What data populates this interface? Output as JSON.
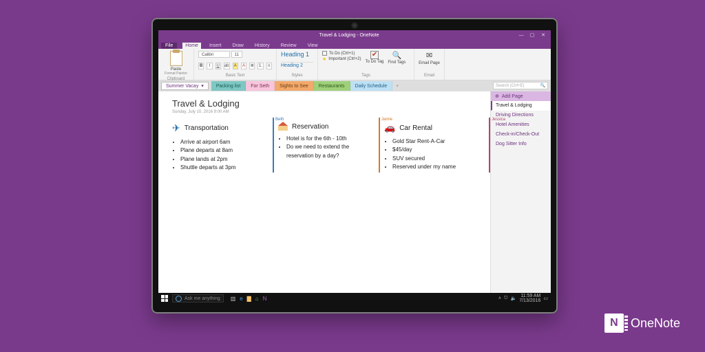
{
  "brand": {
    "letter": "N",
    "name": "OneNote"
  },
  "titlebar": {
    "title": "Travel & Lodging - OneNote",
    "min": "—",
    "max": "▢",
    "close": "✕"
  },
  "tabs": {
    "file": "File",
    "home": "Home",
    "insert": "Insert",
    "draw": "Draw",
    "history": "History",
    "review": "Review",
    "view": "View"
  },
  "ribbon": {
    "paste": "Paste",
    "format_painter": "Format Painter",
    "clipboard_label": "Clipboard",
    "font_name": "Calibri",
    "font_size": "11",
    "btn_bold": "B",
    "btn_italic": "I",
    "btn_underline": "U",
    "basic_label": "Basic Text",
    "heading1": "Heading 1",
    "heading2": "Heading 2",
    "styles_label": "Styles",
    "tag_todo": "To Do (Ctrl+1)",
    "tag_important": "Important (Ctrl+2)",
    "todo_tag_btn": "To Do Tag",
    "find_tags": "Find Tags",
    "tags_label": "Tags",
    "email_page": "Email Page",
    "email_label": "Email"
  },
  "notebook": {
    "name": "Summer Vacay",
    "dropdown_glyph": "▾",
    "sections": {
      "packing": "Packing list",
      "forseth": "For Seth",
      "sights": "Sights to See",
      "restaurants": "Restaurants",
      "daily": "Daily Schedule"
    },
    "add_section": "+",
    "search_placeholder": "Search (Ctrl+E)",
    "search_icon": "🔍"
  },
  "page": {
    "title": "Travel & Lodging",
    "date": "Sunday, July 10, 2016    9:00 AM",
    "col1": {
      "heading": "Transportation",
      "items": [
        "Arrive at airport 6am",
        "Plane departs at 8am",
        "Plane lands at 2pm",
        "Shuttle departs at 3pm"
      ],
      "author": "Beth"
    },
    "col2": {
      "heading": "Reservation",
      "items": [
        "Hotel is for the 6th - 10th",
        "Do we need to extend the reservation by a day?"
      ],
      "author": "Jamie"
    },
    "col3": {
      "heading": "Car Rental",
      "items": [
        "Gold Star Rent-A-Car",
        "$45/day",
        "SUV secured",
        "Reserved under my name"
      ],
      "author": "Jessica"
    }
  },
  "pagelist": {
    "add": "Add Page",
    "add_icon": "⊕",
    "items": [
      "Travel & Lodging",
      "Driving Directions",
      "Hotel Amenities",
      "Check-in/Check-Out",
      "Dog Sitter Info"
    ]
  },
  "taskbar": {
    "cortana": "Ask me anything",
    "time": "11:59 AM",
    "date": "7/13/2016",
    "tray_up": "˄",
    "notif": "▭"
  }
}
